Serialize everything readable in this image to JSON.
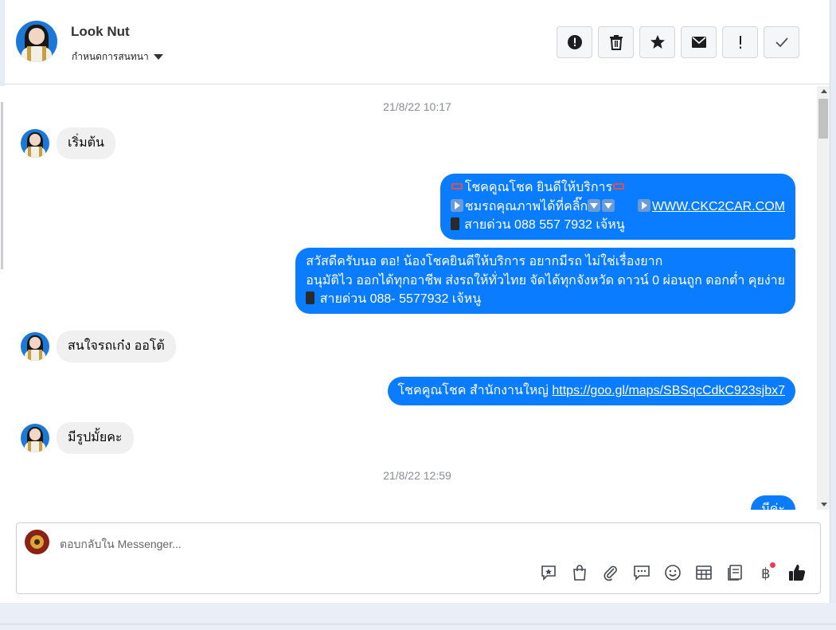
{
  "contact": {
    "name": "Look Nut",
    "assign_label": "กำหนดการสนทนา"
  },
  "header_actions": [
    {
      "name": "spam-button",
      "icon": "alert-circle-icon"
    },
    {
      "name": "delete-button",
      "icon": "trash-icon"
    },
    {
      "name": "star-button",
      "icon": "star-icon"
    },
    {
      "name": "mark-unread-button",
      "icon": "envelope-icon"
    },
    {
      "name": "follow-up-button",
      "icon": "exclamation-icon"
    },
    {
      "name": "mark-done-button",
      "icon": "checkmark-icon"
    }
  ],
  "chat": {
    "timestamps": [
      "21/8/22 10:17",
      "21/8/22 12:59"
    ],
    "incoming": [
      "เริ่มต้น",
      "สนใจรถเก๋ง ออโต้",
      "มีรูปมั้ยคะ"
    ],
    "out1": {
      "line1": "โชคคูณโชค ยินดีให้บริการ",
      "line2a": "ชมรถคุณภาพได้ที่คลิ๊ก",
      "line2_link": "WWW.CKC2CAR.COM",
      "line3": " สายด่วน 088 557 7932 เจ้หนู"
    },
    "out2": {
      "line1": "สวัสดีครับนอ ตอ! น้องโชคยินดีให้บริการ อยากมีรถ ไม่ใช่เรื่องยาก",
      "line2": "อนุมัติไว ออกได้ทุกอาชีพ ส่งรถให้ทั่วไทย จัดได้ทุกจังหวัด ดาวน์ 0  ผ่อนถูก ดอกต่ำ คุยง่าย",
      "line3": " สายด่วน 088- 5577932 เจ้หนู"
    },
    "out3": {
      "text": "โชคคูณโชค สำนักงานใหญ่ ",
      "link": "https://goo.gl/maps/SBSqcCdkC923sjbx7"
    },
    "out4_partial": "มีค่ะ"
  },
  "composer": {
    "placeholder": "ตอบกลับใน Messenger...",
    "tools": [
      "saved-reply-icon",
      "shop-bag-icon",
      "paperclip-icon",
      "chat-bubble-icon",
      "emoji-icon",
      "table-icon",
      "book-icon",
      "baht-icon",
      "thumbs-up-icon"
    ]
  },
  "colors": {
    "accent": "#0a7cff",
    "incoming_bubble": "#f0f0f0",
    "notification_dot": "#e4405a"
  }
}
